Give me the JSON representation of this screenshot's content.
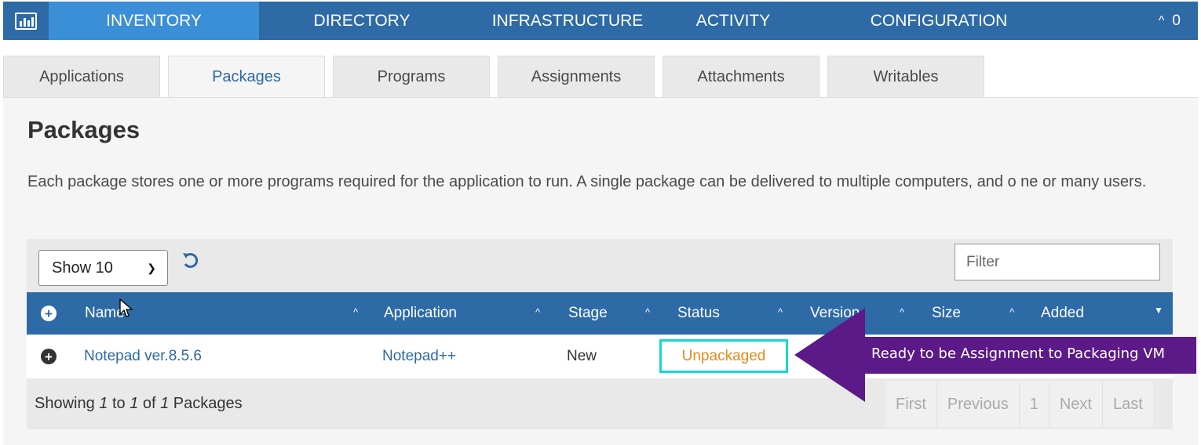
{
  "nav": {
    "items": [
      {
        "label": "INVENTORY"
      },
      {
        "label": "DIRECTORY"
      },
      {
        "label": "INFRASTRUCTURE"
      },
      {
        "label": "ACTIVITY"
      },
      {
        "label": "CONFIGURATION"
      }
    ],
    "alert_count": "0",
    "logo_icon": "bar-chart-icon",
    "active_color": "#3b8fd6",
    "bar_color": "#2d6aa6"
  },
  "tabs": [
    {
      "label": "Applications"
    },
    {
      "label": "Packages"
    },
    {
      "label": "Programs"
    },
    {
      "label": "Assignments"
    },
    {
      "label": "Attachments"
    },
    {
      "label": "Writables"
    }
  ],
  "page": {
    "title": "Packages",
    "description": "Each package stores one or more programs required for the application to run. A single package can be delivered to multiple computers, and o ne or many users."
  },
  "toolbar": {
    "page_size": "Show 10",
    "filter_placeholder": "Filter"
  },
  "table": {
    "columns": [
      {
        "label": "Name"
      },
      {
        "label": "Application"
      },
      {
        "label": "Stage"
      },
      {
        "label": "Status"
      },
      {
        "label": "Version"
      },
      {
        "label": "Size"
      },
      {
        "label": "Added"
      }
    ],
    "rows": [
      {
        "name": "Notepad ver.8.5.6",
        "application": "Notepad++",
        "stage": "New",
        "status": "Unpackaged"
      }
    ],
    "status_color": "#e08a1e"
  },
  "footer": {
    "showing_prefix": "Showing ",
    "from": "1",
    "to_word": " to ",
    "to": "1",
    "of_word": " of ",
    "total": "1",
    "suffix": " Packages"
  },
  "pager": {
    "first": "First",
    "previous": "Previous",
    "current": "1",
    "next": "Next",
    "last": "Last"
  },
  "annotation": {
    "text": "Ready to be Assignment to Packaging VM",
    "color": "#5b1a87",
    "highlight_color": "#19d5d5"
  }
}
